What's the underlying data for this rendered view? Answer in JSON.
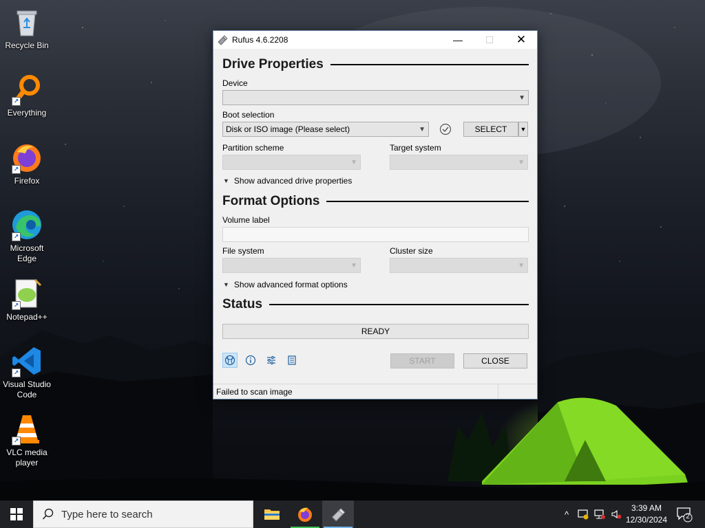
{
  "desktop": {
    "icons": [
      {
        "label": "Recycle Bin",
        "icon": "recycle-bin-icon"
      },
      {
        "label": "Everything",
        "icon": "everything-search-icon"
      },
      {
        "label": "Firefox",
        "icon": "firefox-icon"
      },
      {
        "label": "Microsoft Edge",
        "icon": "edge-icon"
      },
      {
        "label": "Notepad++",
        "icon": "notepadpp-icon"
      },
      {
        "label": "Visual Studio Code",
        "icon": "vscode-icon"
      },
      {
        "label": "VLC media player",
        "icon": "vlc-icon"
      }
    ]
  },
  "window": {
    "title": "Rufus 4.6.2208",
    "controls": {
      "minimize": "—",
      "maximize": "☐",
      "close": "✕"
    }
  },
  "drive_properties": {
    "heading": "Drive Properties",
    "device_label": "Device",
    "device_value": "",
    "boot_label": "Boot selection",
    "boot_value": "Disk or ISO image (Please select)",
    "select_button": "SELECT",
    "partition_label": "Partition scheme",
    "target_label": "Target system",
    "advanced_toggle": "Show advanced drive properties"
  },
  "format_options": {
    "heading": "Format Options",
    "volume_label": "Volume label",
    "volume_value": "",
    "filesystem_label": "File system",
    "cluster_label": "Cluster size",
    "advanced_toggle": "Show advanced format options"
  },
  "status": {
    "heading": "Status",
    "value": "READY"
  },
  "buttons": {
    "start": "START",
    "close": "CLOSE"
  },
  "statusline": {
    "message": "Failed to scan image"
  },
  "taskbar": {
    "search_placeholder": "Type here to search",
    "clock_time": "3:39 AM",
    "clock_date": "12/30/2024",
    "notification_count": "2"
  },
  "colors": {
    "taskbar": "#1f2125",
    "window_bg": "#f0f0f0",
    "accent": "#76b9ed"
  }
}
